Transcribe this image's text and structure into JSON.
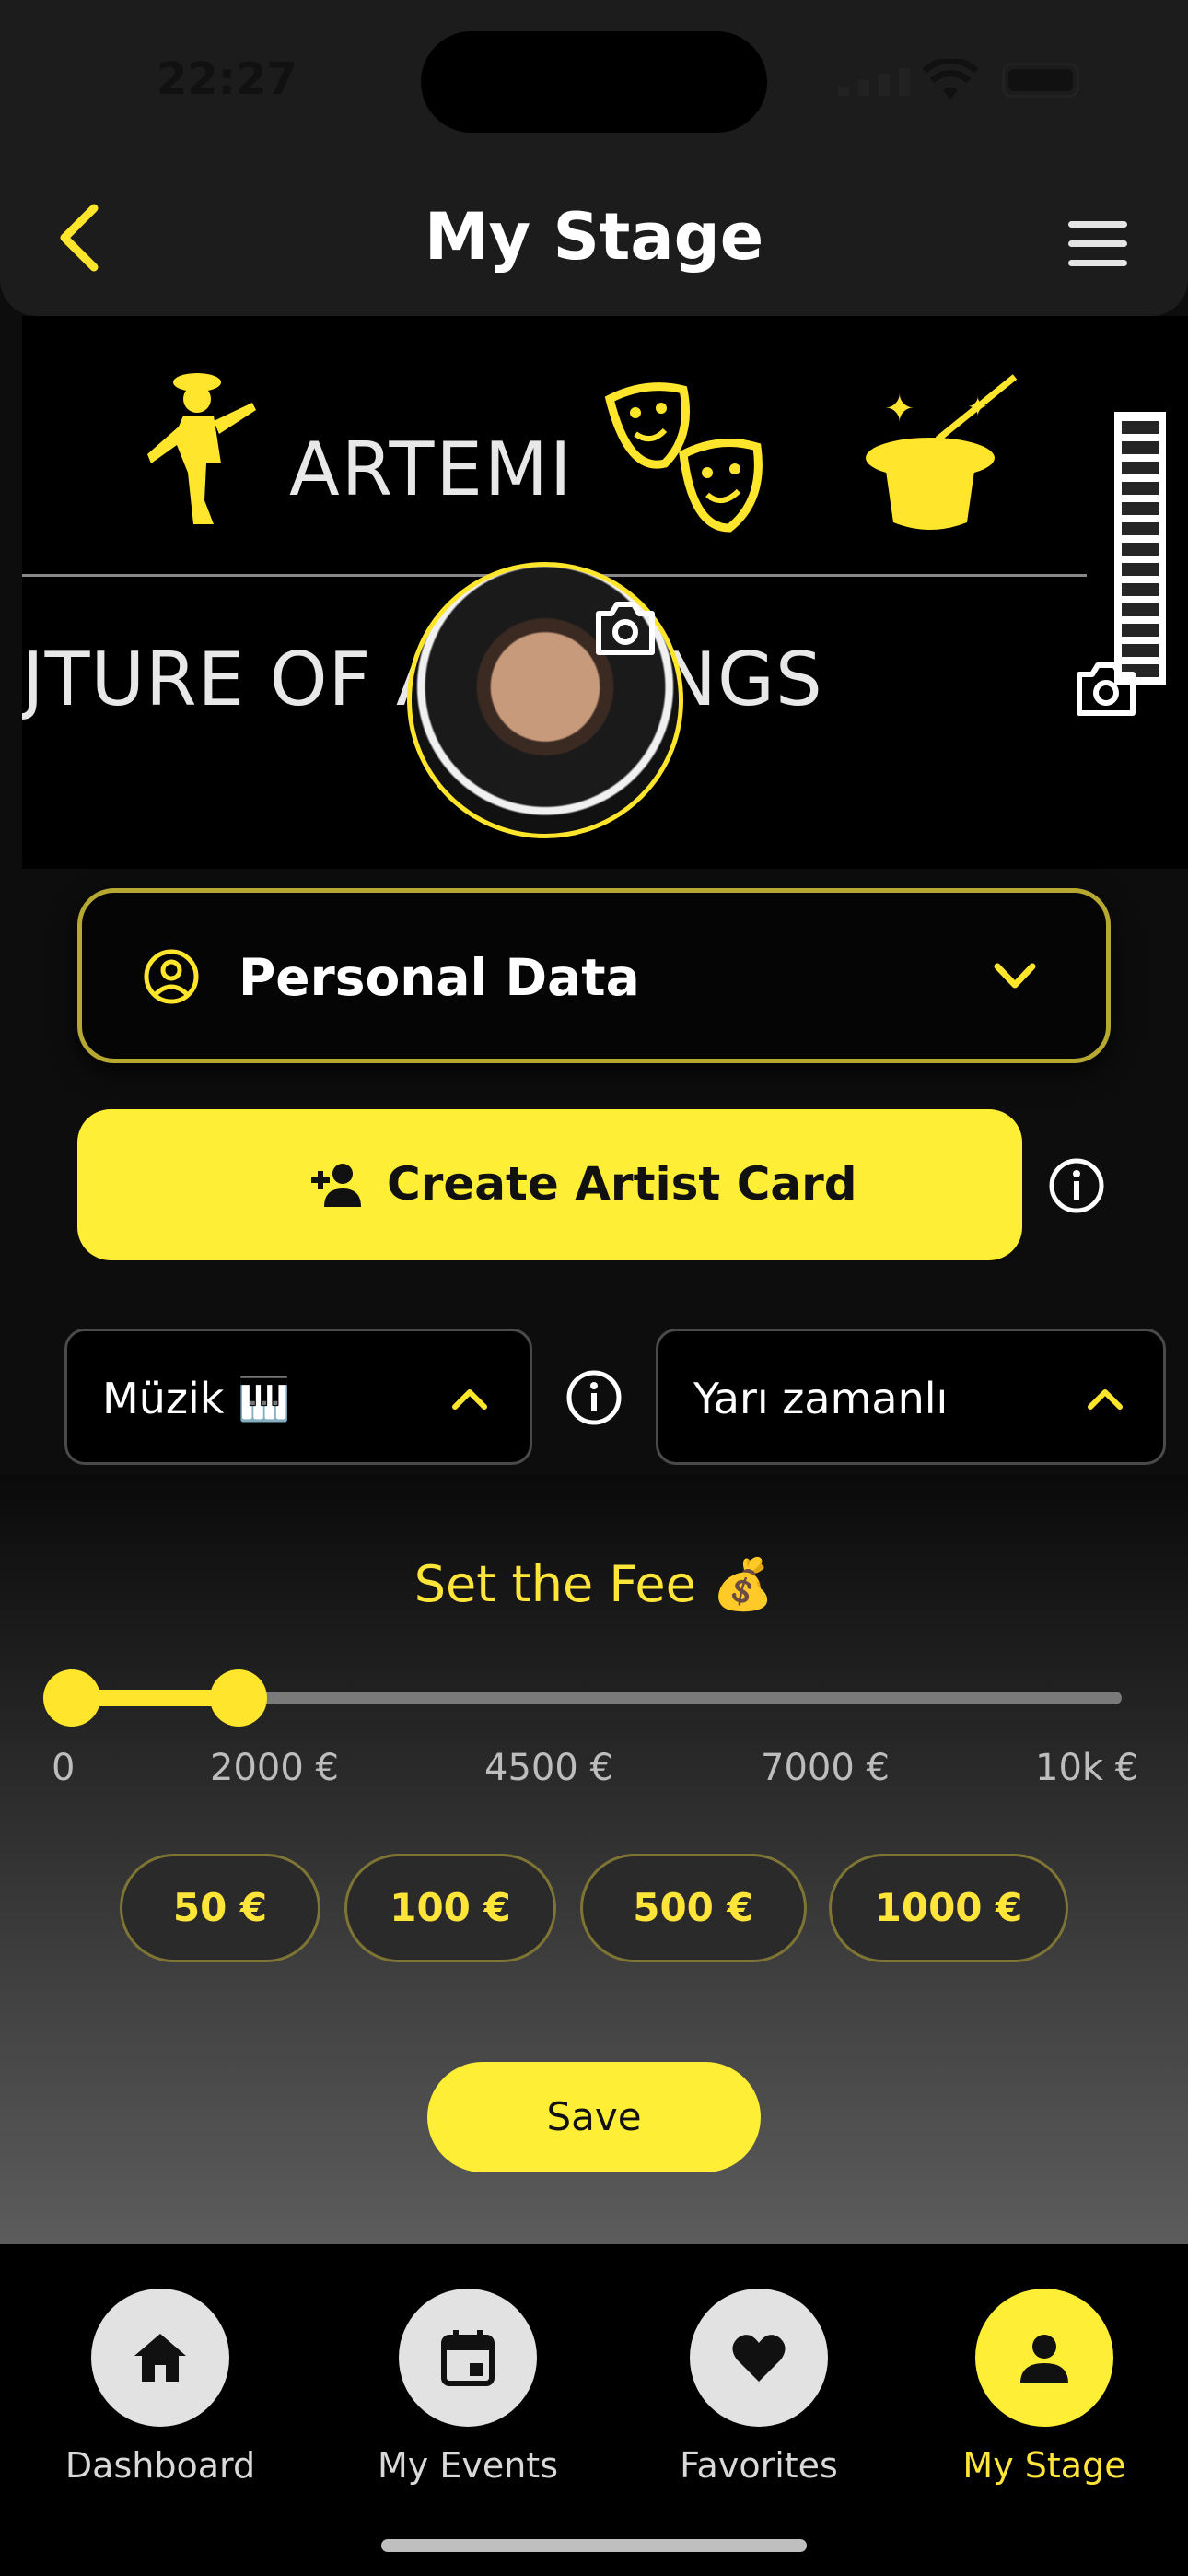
{
  "status_bar": {
    "time": "22:27"
  },
  "header": {
    "title": "My Stage"
  },
  "banner": {
    "text_top": "ARTEMI",
    "text_bottom": "JTURE OF A      OOKINGS"
  },
  "personal_data": {
    "label": "Personal Data"
  },
  "create_card": {
    "label": "Create Artist Card"
  },
  "category_select": {
    "value": "Müzik 🎹"
  },
  "schedule_select": {
    "value": "Yarı zamanlı"
  },
  "fee": {
    "title": "Set the Fee 💰",
    "range_min": 0,
    "range_max": 10000,
    "selected_low": 0,
    "selected_high": 1000,
    "ticks": [
      "0",
      "2000 €",
      "4500 €",
      "7000 €",
      "10k €"
    ],
    "presets": [
      "50 €",
      "100 €",
      "500 €",
      "1000 €"
    ]
  },
  "save_label": "Save",
  "nav": [
    {
      "label": "Dashboard",
      "icon": "home-icon"
    },
    {
      "label": "My Events",
      "icon": "calendar-icon"
    },
    {
      "label": "Favorites",
      "icon": "heart-icon"
    },
    {
      "label": "My Stage",
      "icon": "person-icon",
      "active": true
    }
  ],
  "colors": {
    "accent": "#ffee36",
    "background": "#0d0d0d",
    "nav_circle": "#e2e2e2"
  }
}
